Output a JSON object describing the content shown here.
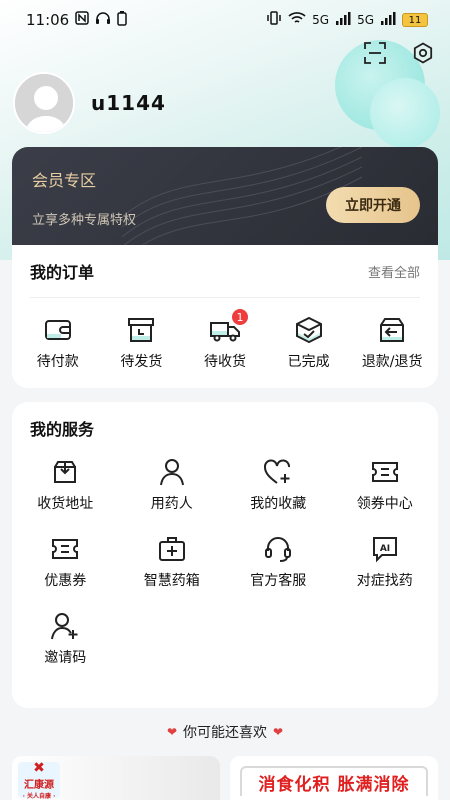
{
  "statusbar": {
    "time": "11:06",
    "battery": "11",
    "net1": "5G",
    "net2": "5G"
  },
  "profile": {
    "username": "u1144"
  },
  "vip": {
    "title": "会员专区",
    "subtitle": "立享多种专属特权",
    "button": "立即开通"
  },
  "orders": {
    "title": "我的订单",
    "view_all": "查看全部",
    "items": [
      {
        "label": "待付款",
        "icon": "wallet-icon"
      },
      {
        "label": "待发货",
        "icon": "box-clock-icon"
      },
      {
        "label": "待收货",
        "icon": "truck-icon",
        "badge": "1"
      },
      {
        "label": "已完成",
        "icon": "box-check-icon"
      },
      {
        "label": "退款/退货",
        "icon": "box-return-icon"
      }
    ]
  },
  "services": {
    "title": "我的服务",
    "items": [
      {
        "label": "收货地址",
        "icon": "address-box-icon"
      },
      {
        "label": "用药人",
        "icon": "person-icon"
      },
      {
        "label": "我的收藏",
        "icon": "heart-plus-icon"
      },
      {
        "label": "领券中心",
        "icon": "ticket-icon"
      },
      {
        "label": "优惠券",
        "icon": "coupon-icon"
      },
      {
        "label": "智慧药箱",
        "icon": "medkit-icon"
      },
      {
        "label": "官方客服",
        "icon": "headset-icon"
      },
      {
        "label": "对症找药",
        "icon": "ai-chat-icon"
      },
      {
        "label": "邀请码",
        "icon": "add-user-icon"
      }
    ]
  },
  "recommend": {
    "title": "你可能还喜欢",
    "product1_brand": "汇康源",
    "product1_tag": "· 关人自康 ·",
    "product2_promo": "消食化积 胀满消除"
  },
  "colors": {
    "accent": "#2a2c34",
    "gold": "#e6c48c",
    "badge": "#ef3d3d"
  }
}
